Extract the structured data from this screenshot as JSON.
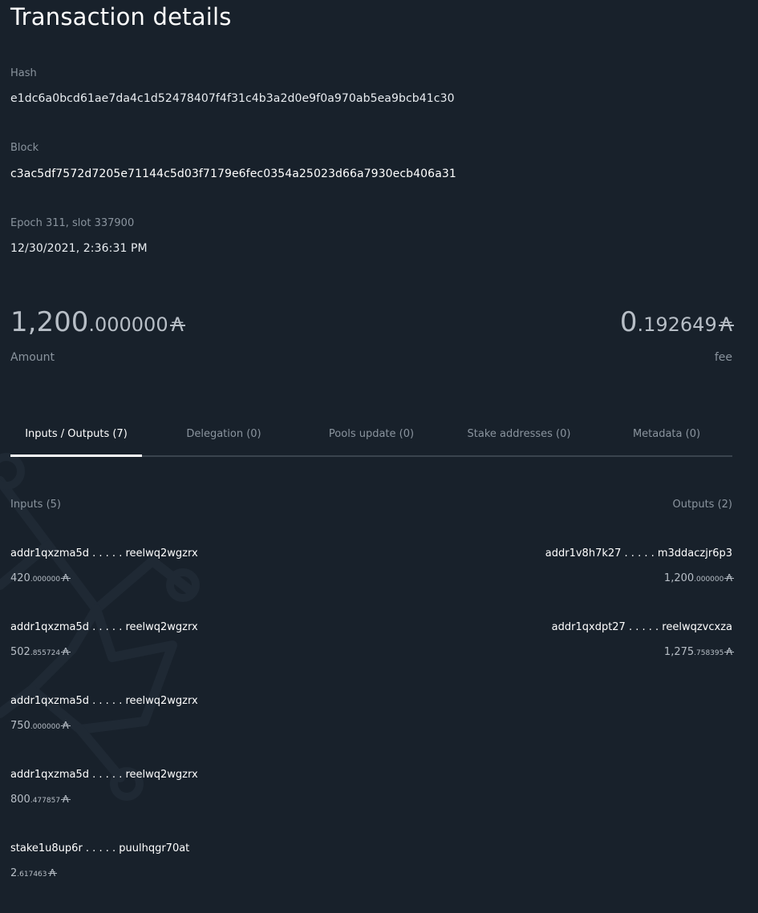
{
  "page": {
    "title": "Transaction details"
  },
  "hash": {
    "label": "Hash",
    "value": "e1dc6a0bcd61ae7da4c1d52478407f4f31c4b3a2d0e9f0a970ab5ea9bcb41c30"
  },
  "block": {
    "label": "Block",
    "value": "c3ac5df7572d7205e71144c5d03f7179e6fec0354a25023d66a7930ecb406a31"
  },
  "timing": {
    "epoch_slot": "Epoch 311, slot 337900",
    "datetime": "12/30/2021, 2:36:31 PM"
  },
  "amount": {
    "integer": "1,200",
    "decimal": ".000000",
    "currency": "₳",
    "label": "Amount"
  },
  "fee": {
    "integer": "0",
    "decimal": ".192649",
    "currency": "₳",
    "label": "fee"
  },
  "tabs": [
    {
      "label": "Inputs / Outputs (7)",
      "active": true
    },
    {
      "label": "Delegation (0)",
      "active": false
    },
    {
      "label": "Pools update (0)",
      "active": false
    },
    {
      "label": "Stake addresses (0)",
      "active": false
    },
    {
      "label": "Metadata (0)",
      "active": false
    }
  ],
  "inputs": {
    "heading": "Inputs (5)",
    "items": [
      {
        "address": "addr1qxzma5d . . . . . reelwq2wgzrx",
        "integer": "420",
        "decimal": ".000000",
        "currency": "₳"
      },
      {
        "address": "addr1qxzma5d . . . . . reelwq2wgzrx",
        "integer": "502",
        "decimal": ".855724",
        "currency": "₳"
      },
      {
        "address": "addr1qxzma5d . . . . . reelwq2wgzrx",
        "integer": "750",
        "decimal": ".000000",
        "currency": "₳"
      },
      {
        "address": "addr1qxzma5d . . . . . reelwq2wgzrx",
        "integer": "800",
        "decimal": ".477857",
        "currency": "₳"
      },
      {
        "address": "stake1u8up6r . . . . . puulhqgr70at",
        "integer": "2",
        "decimal": ".617463",
        "currency": "₳"
      }
    ]
  },
  "outputs": {
    "heading": "Outputs (2)",
    "items": [
      {
        "address": "addr1v8h7k27 . . . . . m3ddaczjr6p3",
        "integer": "1,200",
        "decimal": ".000000",
        "currency": "₳"
      },
      {
        "address": "addr1qxdpt27 . . . . . reelwqzvcxza",
        "integer": "1,275",
        "decimal": ".758395",
        "currency": "₳"
      }
    ]
  },
  "colors": {
    "background": "#18212b",
    "muted_text": "#8a949e",
    "amount_text": "#b7bec6",
    "tab_divider": "#3a444e",
    "active_tab": "#ffffff"
  }
}
